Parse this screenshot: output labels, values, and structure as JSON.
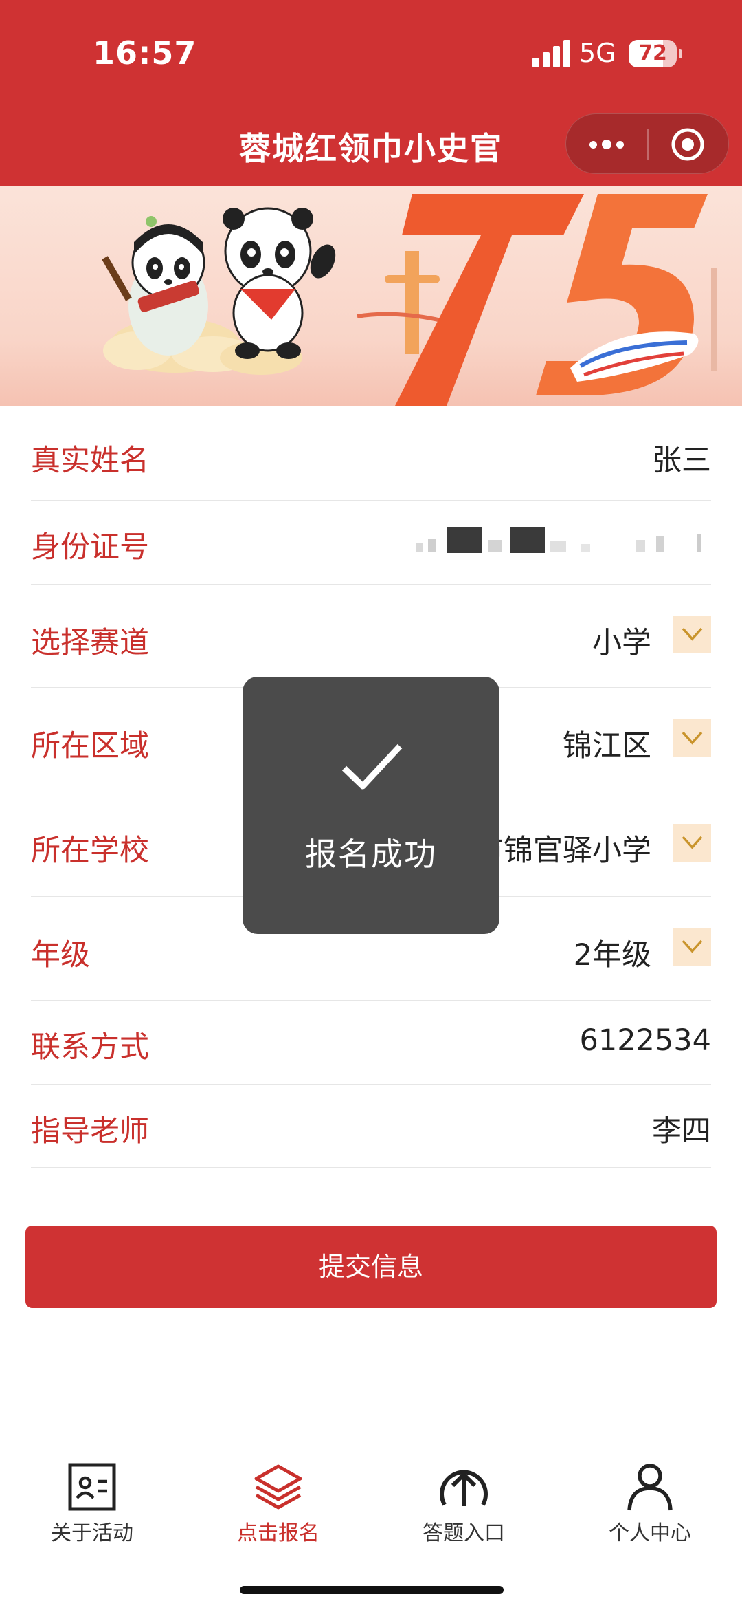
{
  "status_bar": {
    "time": "16:57",
    "network": "5G",
    "battery": 72,
    "battery_label": "72"
  },
  "header": {
    "title": "蓉城红领巾小史官",
    "more_icon": "more-dots-icon",
    "close_icon": "target-circle-icon"
  },
  "banner": {
    "number": "75"
  },
  "form": {
    "name": {
      "label": "真实姓名",
      "value": "张三"
    },
    "id_number": {
      "label": "身份证号"
    },
    "track": {
      "label": "选择赛道",
      "value": "小学"
    },
    "district": {
      "label": "所在区域",
      "value": "锦江区"
    },
    "school": {
      "label": "所在学校",
      "value": "市锦官驿小学"
    },
    "grade": {
      "label": "年级",
      "value": "2年级"
    },
    "contact": {
      "label": "联系方式",
      "value": "6122534"
    },
    "teacher": {
      "label": "指导老师",
      "value": "李四"
    }
  },
  "submit_label": "提交信息",
  "toast": {
    "text": "报名成功",
    "icon": "checkmark-icon"
  },
  "tabbar": {
    "items": [
      {
        "label": "关于活动",
        "icon": "id-card-icon"
      },
      {
        "label": "点击报名",
        "icon": "layers-icon",
        "active": true
      },
      {
        "label": "答题入口",
        "icon": "upload-arrow-circle-icon"
      },
      {
        "label": "个人中心",
        "icon": "person-icon"
      }
    ]
  },
  "colors": {
    "primary": "#cf3233",
    "label": "#c9302c",
    "dropdown_bg": "#fbe7cf",
    "toast_bg": "#4b4b4b"
  }
}
